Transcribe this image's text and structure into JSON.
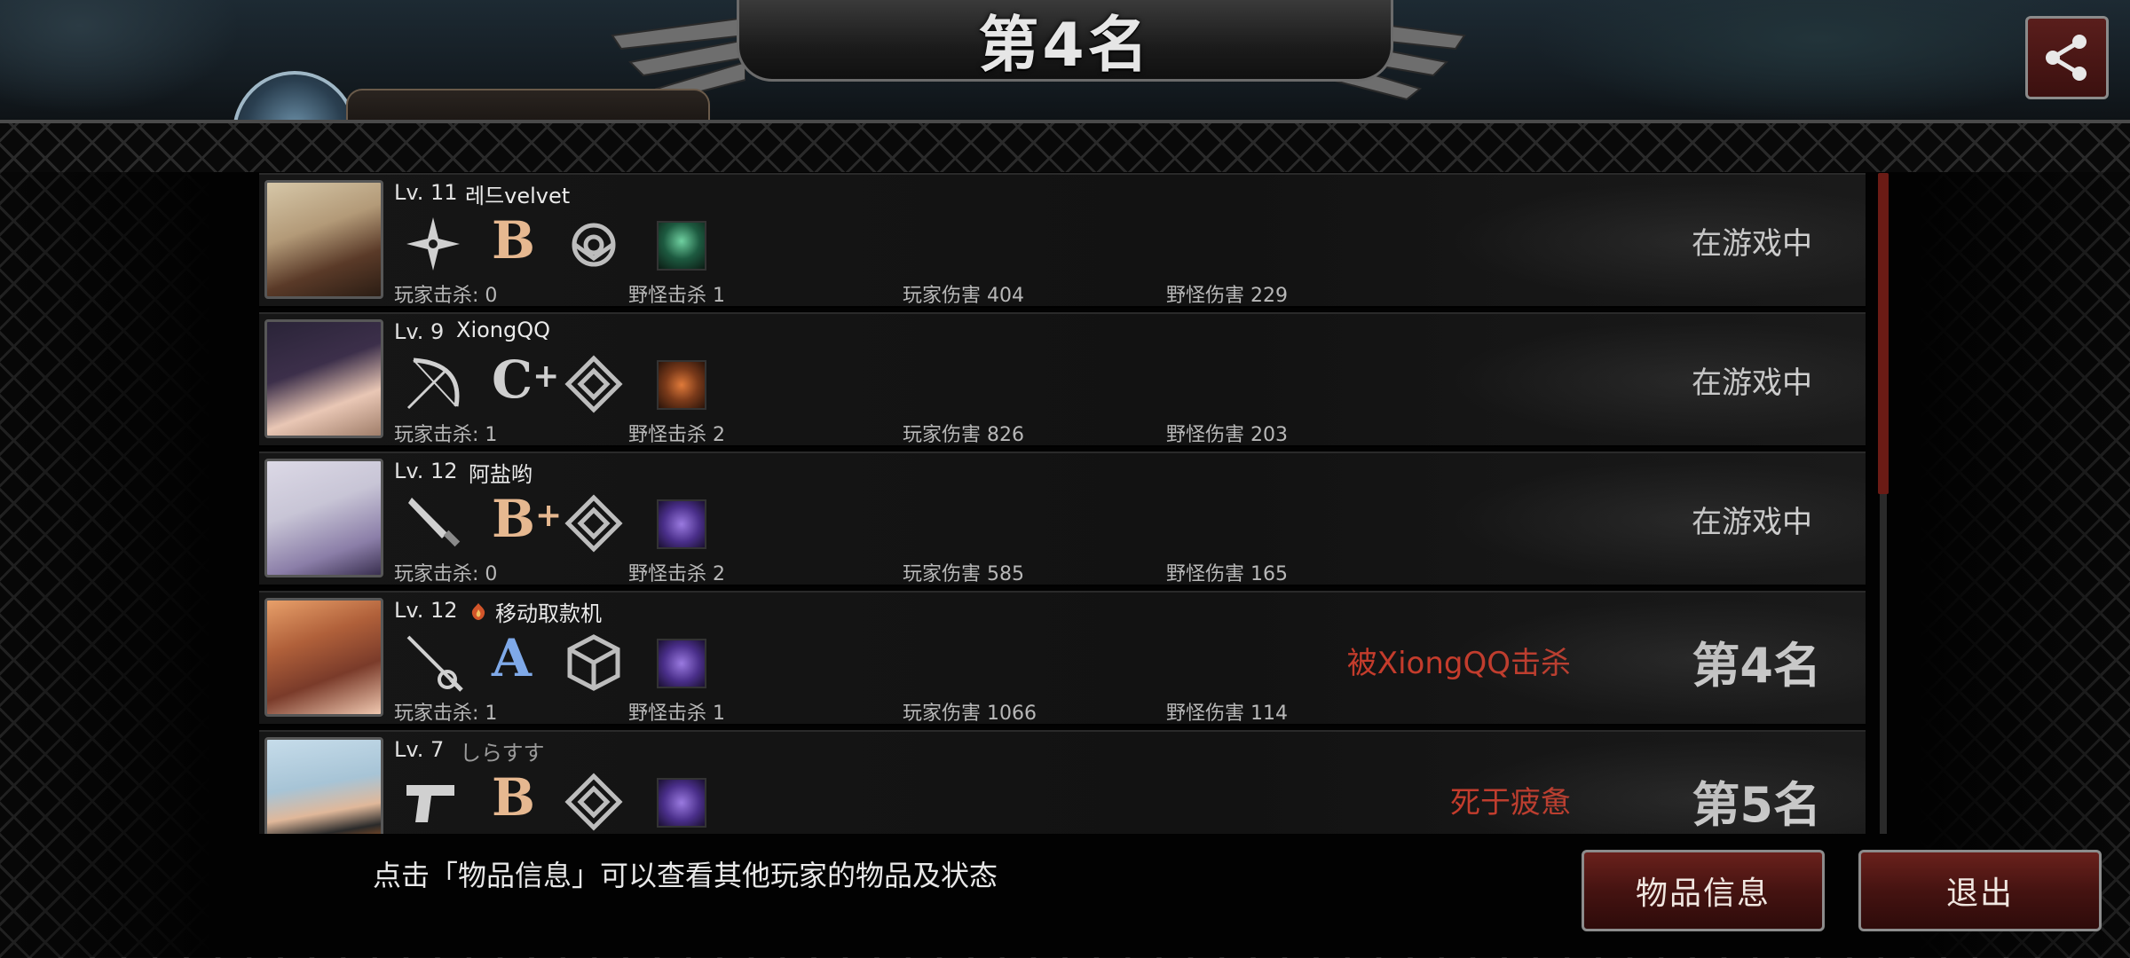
{
  "header": {
    "title": "第4名",
    "share_icon": "share-icon"
  },
  "players": [
    {
      "level": "Lv. 11",
      "name": "레드velvet",
      "weapon_icon": "shuriken-icon",
      "grade": "B",
      "grade_plus": "",
      "stats": {
        "player_kills": "玩家击杀: 0",
        "monster_kills": "野怪击杀 1",
        "player_damage": "玩家伤害 404",
        "monster_damage": "野怪伤害 229"
      },
      "status": "在游戏中",
      "death_text": "",
      "avatar_colors": [
        "#c9b79a",
        "#5a3a28"
      ]
    },
    {
      "level": "Lv. 9",
      "name": "XiongQQ",
      "weapon_icon": "bow-icon",
      "grade": "C",
      "grade_plus": "+",
      "stats": {
        "player_kills": "玩家击杀: 1",
        "monster_kills": "野怪击杀 2",
        "player_damage": "玩家伤害 826",
        "monster_damage": "野怪伤害 203"
      },
      "status": "在游戏中",
      "death_text": "",
      "avatar_colors": [
        "#2a2438",
        "#e9c7b5"
      ]
    },
    {
      "level": "Lv. 12",
      "name": "阿盐哟",
      "weapon_icon": "knife-icon",
      "grade": "B",
      "grade_plus": "+",
      "stats": {
        "player_kills": "玩家击杀: 0",
        "monster_kills": "野怪击杀 2",
        "player_damage": "玩家伤害 585",
        "monster_damage": "野怪伤害 165"
      },
      "status": "在游戏中",
      "death_text": "",
      "avatar_colors": [
        "#c8c5d6",
        "#8b7ea8"
      ]
    },
    {
      "level": "Lv. 12",
      "name": "移动取款机",
      "weapon_icon": "rapier-icon",
      "grade": "A",
      "grade_plus": "",
      "stats": {
        "player_kills": "玩家击杀: 1",
        "monster_kills": "野怪击杀 1",
        "player_damage": "玩家伤害 1066",
        "monster_damage": "野怪伤害 114"
      },
      "status": "第4名",
      "death_text": "被XiongQQ击杀",
      "avatar_colors": [
        "#7a3b2a",
        "#e8a06a"
      ]
    },
    {
      "level": "Lv. 7",
      "name": "しらすす",
      "weapon_icon": "pistol-icon",
      "grade": "B",
      "grade_plus": "",
      "stats": {
        "player_kills": "",
        "monster_kills": "",
        "player_damage": "",
        "monster_damage": ""
      },
      "status": "第5名",
      "death_text": "死于疲惫",
      "avatar_colors": [
        "#a7c4d6",
        "#e07020"
      ]
    }
  ],
  "footer": {
    "hint": "点击「物品信息」可以查看其他玩家的物品及状态",
    "items_button": "物品信息",
    "exit_button": "退出"
  }
}
